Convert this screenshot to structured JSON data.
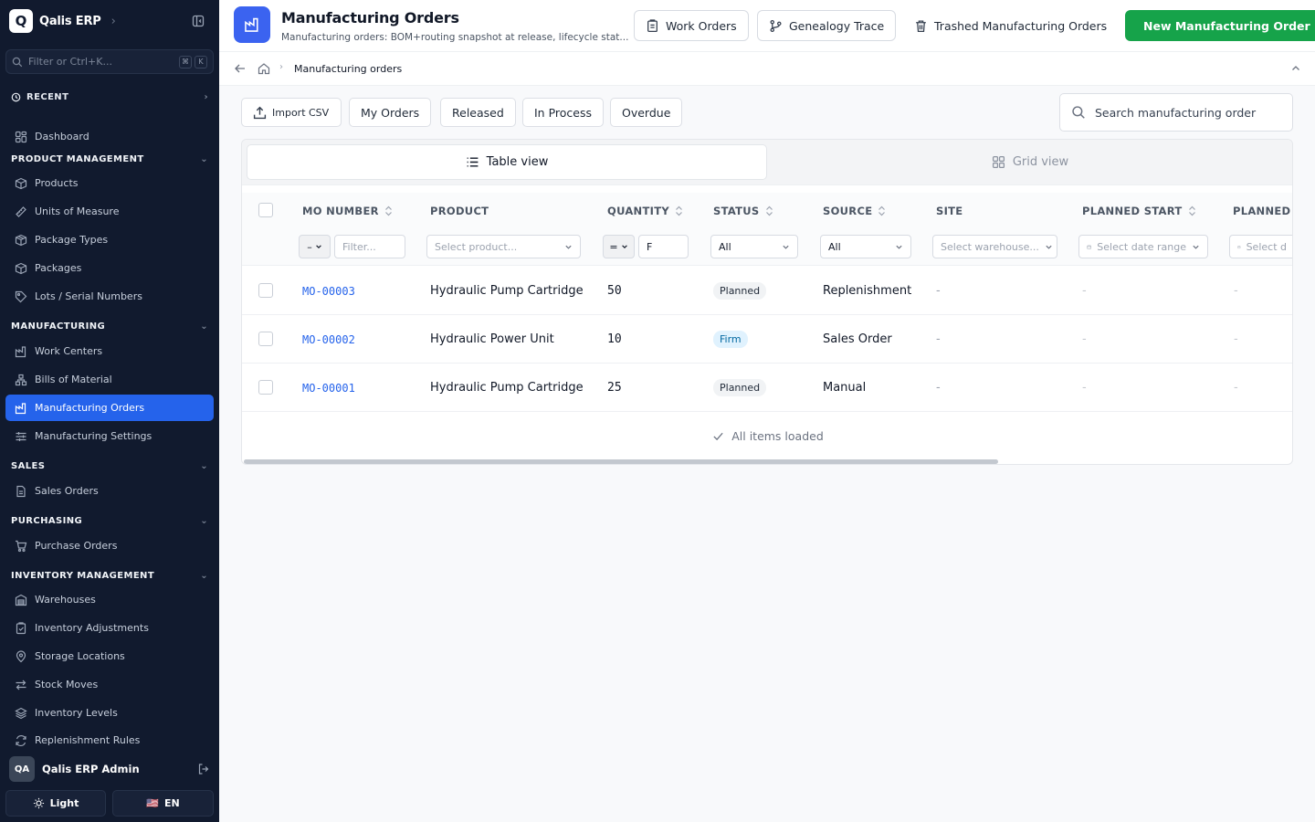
{
  "app": {
    "logo_letter": "Q",
    "name": "Qalis ERP"
  },
  "sidebar": {
    "filter_placeholder": "Filter or Ctrl+K...",
    "kbd": [
      "⌘",
      "K"
    ],
    "recent_label": "RECENT",
    "dashboard": "Dashboard",
    "sections": {
      "product": "PRODUCT MANAGEMENT",
      "manufacturing": "MANUFACTURING",
      "sales": "SALES",
      "purchasing": "PURCHASING",
      "inventory": "INVENTORY MANAGEMENT"
    },
    "items": {
      "products": "Products",
      "uom": "Units of Measure",
      "package_types": "Package Types",
      "packages": "Packages",
      "lots": "Lots / Serial Numbers",
      "work_centers": "Work Centers",
      "bom": "Bills of Material",
      "mo": "Manufacturing Orders",
      "mfg_settings": "Manufacturing Settings",
      "sales_orders": "Sales Orders",
      "purchase_orders": "Purchase Orders",
      "warehouses": "Warehouses",
      "inv_adjust": "Inventory Adjustments",
      "storage": "Storage Locations",
      "stock_moves": "Stock Moves",
      "inv_levels": "Inventory Levels",
      "replenish": "Replenishment Rules"
    },
    "user": {
      "initials": "QA",
      "name": "Qalis ERP Admin"
    },
    "theme_label": "Light",
    "lang_flag": "🇺🇸",
    "lang_label": "EN"
  },
  "header": {
    "title": "Manufacturing Orders",
    "subtitle": "Manufacturing orders: BOM+routing snapshot at release, lifecycle stat...",
    "buttons": {
      "work_orders": "Work Orders",
      "genealogy": "Genealogy Trace",
      "trashed": "Trashed Manufacturing Orders",
      "new": "New Manufacturing Order"
    }
  },
  "breadcrumb": {
    "current": "Manufacturing orders"
  },
  "toolbar": {
    "import": "Import CSV",
    "filters": [
      "My Orders",
      "Released",
      "In Process",
      "Overdue"
    ],
    "search_placeholder": "Search manufacturing order"
  },
  "views": {
    "table": "Table view",
    "grid": "Grid view"
  },
  "table": {
    "columns": [
      "MO NUMBER",
      "PRODUCT",
      "QUANTITY",
      "STATUS",
      "SOURCE",
      "SITE",
      "PLANNED START",
      "PLANNED E"
    ],
    "filters": {
      "mo_op": "–",
      "mo_placeholder": "Filter...",
      "product_placeholder": "Select product...",
      "qty_op": "=",
      "qty_value": "F",
      "status_value": "All",
      "source_value": "All",
      "site_placeholder": "Select warehouse...",
      "start_placeholder": "Select date range",
      "end_placeholder": "Select d"
    },
    "rows": [
      {
        "mo": "MO-00003",
        "product": "Hydraulic Pump Cartridge",
        "qty": "50",
        "status": "Planned",
        "source": "Replenishment",
        "site": "-",
        "start": "-",
        "end": "-"
      },
      {
        "mo": "MO-00002",
        "product": "Hydraulic Power Unit",
        "qty": "10",
        "status": "Firm",
        "source": "Sales Order",
        "site": "-",
        "start": "-",
        "end": "-"
      },
      {
        "mo": "MO-00001",
        "product": "Hydraulic Pump Cartridge",
        "qty": "25",
        "status": "Planned",
        "source": "Manual",
        "site": "-",
        "start": "-",
        "end": "-"
      }
    ],
    "footer": "All items loaded"
  },
  "colors": {
    "sidebar_bg": "#111a2e",
    "accent": "#2563eb",
    "primary_button": "#16a34a",
    "link": "#2563eb"
  }
}
